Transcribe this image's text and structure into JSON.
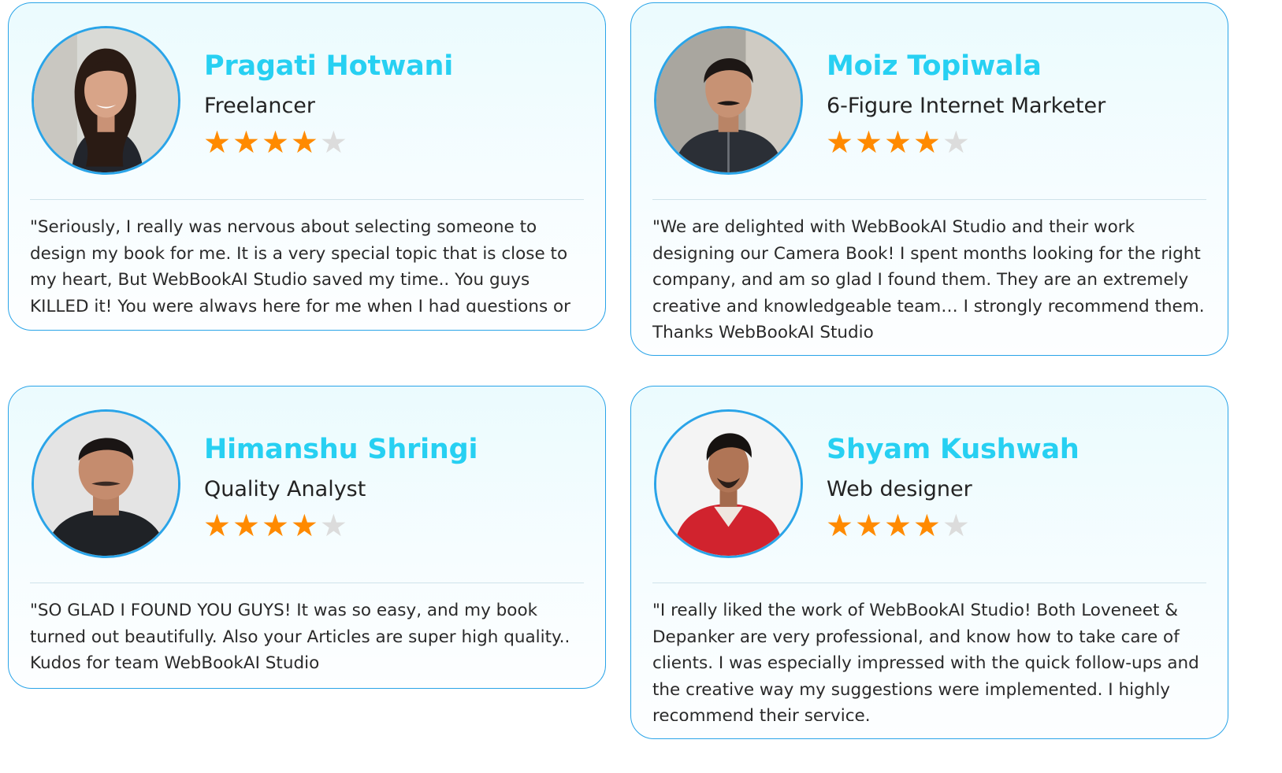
{
  "rating_max": 5,
  "testimonials": [
    {
      "name": "Pragati Hotwani",
      "role": "Freelancer",
      "rating": 4,
      "avatar": "person-portrait-woman",
      "quote": "\"Seriously, I really was nervous about selecting someone to design my book for me. It is a very special topic that is close to my heart, But WebBookAI Studio saved my time.. You guys KILLED it! You were always here for me when I had questions or"
    },
    {
      "name": "Moiz Topiwala",
      "role": "6-Figure Internet Marketer",
      "rating": 4,
      "avatar": "person-portrait-man",
      "quote": "\"We are delighted with WebBookAI Studio and their work designing our Camera Book! I spent months looking for the right company, and am so glad I found them. They are an extremely creative and knowledgeable team… I strongly recommend them. Thanks WebBookAI Studio"
    },
    {
      "name": "Himanshu Shringi",
      "role": "Quality Analyst",
      "rating": 4,
      "avatar": "person-portrait-man",
      "quote": "\"SO GLAD I FOUND YOU GUYS! It was so easy, and my book turned out beautifully. Also your Articles are super high quality.. Kudos for team WebBookAI Studio"
    },
    {
      "name": "Shyam Kushwah",
      "role": "Web designer",
      "rating": 4,
      "avatar": "person-portrait-man",
      "quote": "\"I really liked the work of WebBookAI Studio! Both Loveneet & Depanker are very professional, and know how to take care of clients. I was especially impressed with the quick follow-ups and the creative way my suggestions were implemented. I highly recommend their service."
    }
  ],
  "colors": {
    "accent_border": "#2aa4e8",
    "name_color": "#27d0f2",
    "star_filled": "#ff8a00",
    "star_empty": "#dcdcdc"
  }
}
